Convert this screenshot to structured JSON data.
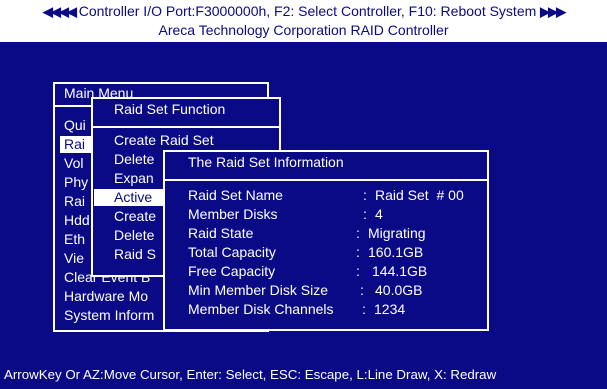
{
  "header": {
    "left_arrows": "◀◀◀◀",
    "title_line1": "Controller I/O Port:F3000000h, F2: Select Controller, F10: Reboot System",
    "right_arrows": "▶▶▶",
    "title_line2": "Areca Technology Corporation RAID Controller"
  },
  "main_menu": {
    "title": "Main Menu",
    "items": [
      "Qui",
      "Rai",
      "Vol",
      "Phy",
      "Rai",
      "Hdd",
      "Eth",
      "Vie",
      "Clear Event B",
      "Hardware Mo",
      "System Inform"
    ]
  },
  "raid_set_function": {
    "title": "Raid Set Function",
    "items": [
      "Create Raid Set",
      "Delete",
      "Expan",
      "Active",
      "Create",
      "Delete",
      "Raid S"
    ],
    "selected_index": 3
  },
  "raid_info": {
    "title": "The Raid Set Information",
    "rows": [
      {
        "label": "Raid Set Name",
        "sep": ":",
        "value": "Raid Set  # 00"
      },
      {
        "label": "Member Disks",
        "sep": ":",
        "value": "4"
      },
      {
        "label": "Raid State",
        "sep": ":",
        "value": "Migrating"
      },
      {
        "label": "Total Capacity",
        "sep": ":",
        "value": "160.1GB"
      },
      {
        "label": "Free Capacity",
        "sep": ":",
        "value": "144.1GB"
      },
      {
        "label": "Min Member Disk Size",
        "sep": ":",
        "value": "40.0GB"
      },
      {
        "label": "Member Disk Channels",
        "sep": ":",
        "value": "1234"
      }
    ]
  },
  "footer": {
    "help": "ArrowKey Or AZ:Move Cursor, Enter: Select, ESC: Escape, L:Line Draw, X: Redraw"
  },
  "colors": {
    "background": "#0a0a86",
    "foreground": "#ffffff"
  }
}
